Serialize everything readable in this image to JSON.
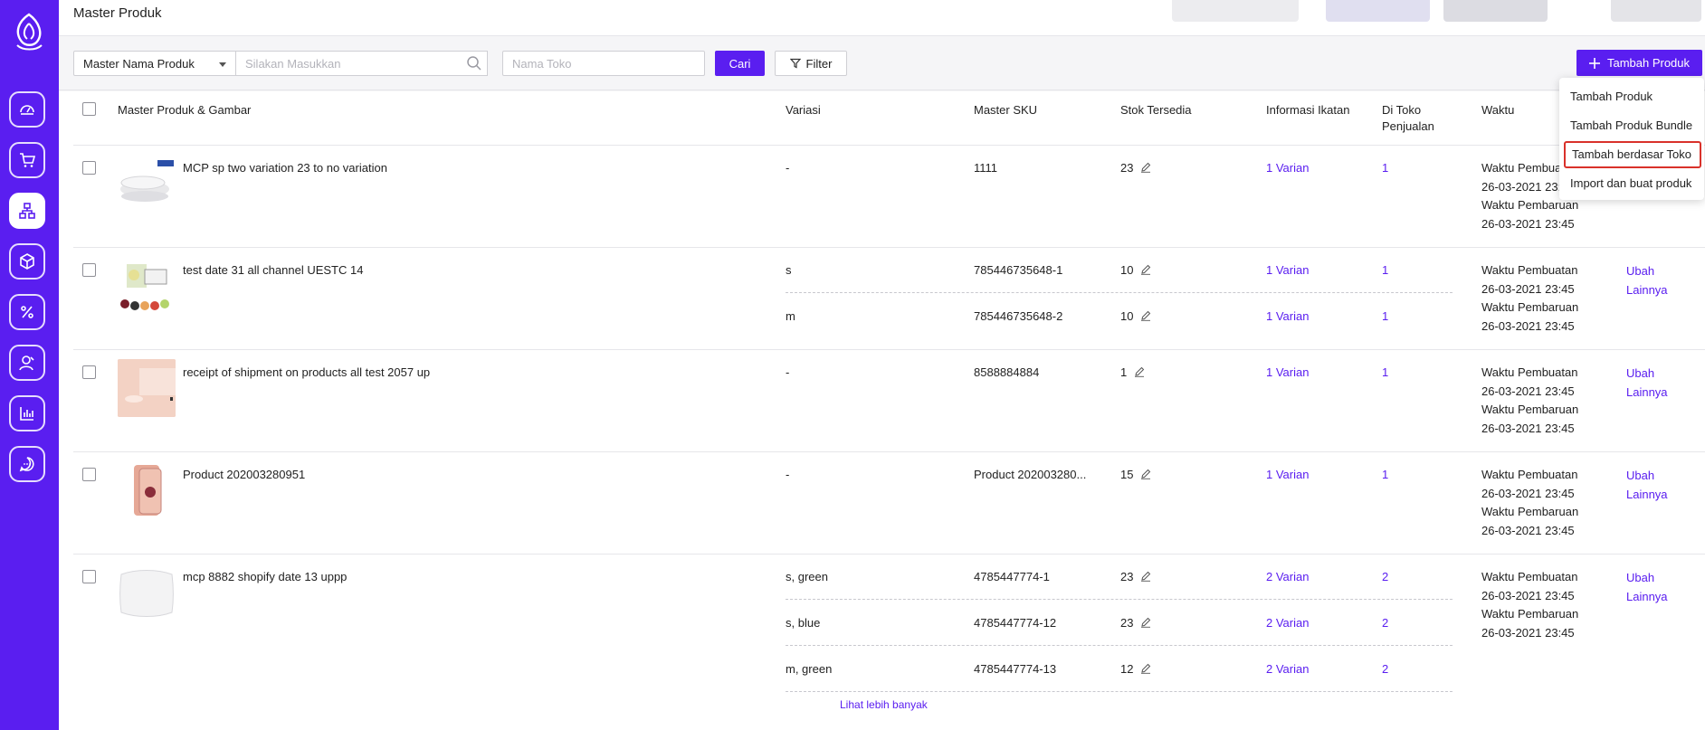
{
  "header": {
    "title": "Master Produk"
  },
  "search": {
    "field_select": "Master Nama Produk",
    "keyword_placeholder": "Silakan Masukkan",
    "store_placeholder": "Nama Toko",
    "search_button": "Cari",
    "filter_button": "Filter",
    "add_button": "Tambah Produk"
  },
  "table": {
    "columns": [
      "Master Produk & Gambar",
      "Variasi",
      "Master SKU",
      "Stok Tersedia",
      "Informasi Ikatan",
      "Di Toko Penjualan",
      "Waktu"
    ],
    "rows": [
      {
        "name": "MCP sp two variation 23 to no variation",
        "variants": [
          {
            "variasi": "-",
            "sku": "1111",
            "stock": "23",
            "ikatan": "1 Varian",
            "toko": "1"
          }
        ],
        "created_label": "Waktu Pembuatan",
        "created": "26-03-2021 23:45",
        "updated_label": "Waktu Pembaruan",
        "updated": "26-03-2021 23:45",
        "action_edit": "",
        "action_more": ""
      },
      {
        "name": "test date 31 all channel UESTC 14",
        "variants": [
          {
            "variasi": "s",
            "sku": "785446735648-1",
            "stock": "10",
            "ikatan": "1 Varian",
            "toko": "1"
          },
          {
            "variasi": "m",
            "sku": "785446735648-2",
            "stock": "10",
            "ikatan": "1 Varian",
            "toko": "1"
          }
        ],
        "created_label": "Waktu Pembuatan",
        "created": "26-03-2021 23:45",
        "updated_label": "Waktu Pembaruan",
        "updated": "26-03-2021 23:45",
        "action_edit": "Ubah",
        "action_more": "Lainnya"
      },
      {
        "name": "receipt of shipment on products all test 2057 up",
        "variants": [
          {
            "variasi": "-",
            "sku": "8588884884",
            "stock": "1",
            "ikatan": "1 Varian",
            "toko": "1"
          }
        ],
        "created_label": "Waktu Pembuatan",
        "created": "26-03-2021 23:45",
        "updated_label": "Waktu Pembaruan",
        "updated": "26-03-2021 23:45",
        "action_edit": "Ubah",
        "action_more": "Lainnya"
      },
      {
        "name": "Product 202003280951",
        "variants": [
          {
            "variasi": "-",
            "sku": "Product 202003280...",
            "stock": "15",
            "ikatan": "1 Varian",
            "toko": "1"
          }
        ],
        "created_label": "Waktu Pembuatan",
        "created": "26-03-2021 23:45",
        "updated_label": "Waktu Pembaruan",
        "updated": "26-03-2021 23:45",
        "action_edit": "Ubah",
        "action_more": "Lainnya"
      },
      {
        "name": "mcp 8882 shopify date 13 uppp",
        "variants": [
          {
            "variasi": "s, green",
            "sku": "4785447774-1",
            "stock": "23",
            "ikatan": "2 Varian",
            "toko": "2"
          },
          {
            "variasi": "s, blue",
            "sku": "4785447774-12",
            "stock": "23",
            "ikatan": "2 Varian",
            "toko": "2"
          },
          {
            "variasi": "m, green",
            "sku": "4785447774-13",
            "stock": "12",
            "ikatan": "2 Varian",
            "toko": "2"
          }
        ],
        "see_more": "Lihat lebih banyak",
        "created_label": "Waktu Pembuatan",
        "created": "26-03-2021 23:45",
        "updated_label": "Waktu Pembaruan",
        "updated": "26-03-2021 23:45",
        "action_edit": "Ubah",
        "action_more": "Lainnya"
      }
    ]
  },
  "dropdown": {
    "items": [
      "Tambah Produk",
      "Tambah Produk Bundle",
      "Tambah berdasar Toko",
      "Import dan buat produk"
    ]
  },
  "sidebar": {
    "icons": [
      "dashboard-icon",
      "cart-icon",
      "product-tree-icon",
      "package-icon",
      "percent-icon",
      "user-icon",
      "chart-icon",
      "chat-icon"
    ]
  },
  "colors": {
    "brand": "#5a1ef0",
    "highlight_border": "#d9312a"
  }
}
